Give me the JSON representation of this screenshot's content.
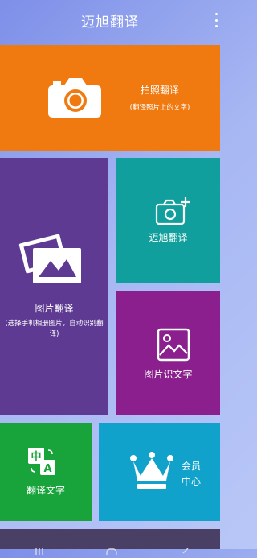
{
  "app": {
    "title": "迈旭翻译"
  },
  "tiles": {
    "photo": {
      "title": "拍照翻译",
      "subtitle": "(翻译照片上的文字)"
    },
    "image": {
      "title": "图片翻译",
      "subtitle": "(选择手机相册图片，自动识别翻译)"
    },
    "maixu": {
      "title": "迈旭翻译"
    },
    "ocr": {
      "title": "图片识文字"
    },
    "text": {
      "title": "翻译文字",
      "icon_glyph_cn": "中",
      "icon_glyph_en": "A"
    },
    "vip": {
      "title_line1": "会员",
      "title_line2": "中心"
    }
  },
  "colors": {
    "photo": "#f07a10",
    "image": "#5e3a93",
    "maixu": "#109f9c",
    "ocr": "#8b1f8d",
    "text": "#18a43b",
    "vip": "#11a2cb",
    "navbar": "#4a3f64"
  },
  "icons": {
    "photo": "camera-icon",
    "image": "photos-icon",
    "maixu": "camera-plus-icon",
    "ocr": "image-icon",
    "text": "translate-icon",
    "vip": "crown-icon",
    "menu": "more-vertical-icon",
    "nav": [
      "recent-apps-icon",
      "home-icon",
      "back-icon"
    ]
  }
}
